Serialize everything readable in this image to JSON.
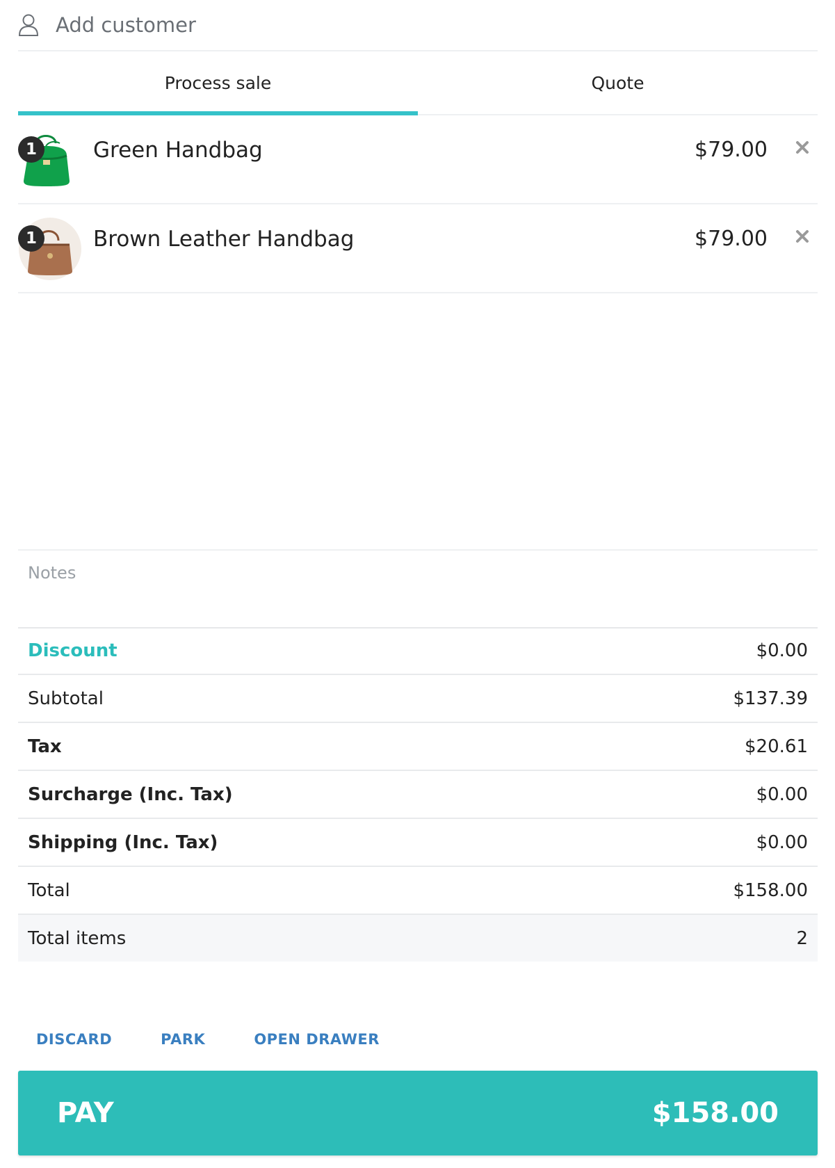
{
  "customer": {
    "label": "Add customer",
    "icon": "user-icon"
  },
  "tabs": [
    {
      "label": "Process sale",
      "active": true
    },
    {
      "label": "Quote",
      "active": false
    }
  ],
  "accent_color": "#35c2c9",
  "items": [
    {
      "name": "Green Handbag",
      "price": "$79.00",
      "qty": "1",
      "thumb_icon": "green-handbag-thumbnail"
    },
    {
      "name": "Brown Leather Handbag",
      "price": "$79.00",
      "qty": "1",
      "thumb_icon": "brown-handbag-thumbnail"
    }
  ],
  "notes": {
    "placeholder": "Notes",
    "value": ""
  },
  "summary": {
    "discount": {
      "label": "Discount",
      "value": "$0.00"
    },
    "subtotal": {
      "label": "Subtotal",
      "value": "$137.39"
    },
    "tax": {
      "label": "Tax",
      "value": "$20.61"
    },
    "surcharge": {
      "label": "Surcharge (Inc. Tax)",
      "value": "$0.00"
    },
    "shipping": {
      "label": "Shipping (Inc. Tax)",
      "value": "$0.00"
    },
    "total": {
      "label": "Total",
      "value": "$158.00"
    },
    "total_items": {
      "label": "Total items",
      "value": "2"
    }
  },
  "actions": {
    "discard": "DISCARD",
    "park": "PARK",
    "open_drawer": "OPEN DRAWER"
  },
  "pay": {
    "label": "PAY",
    "amount": "$158.00",
    "color": "#2dbdb8"
  }
}
